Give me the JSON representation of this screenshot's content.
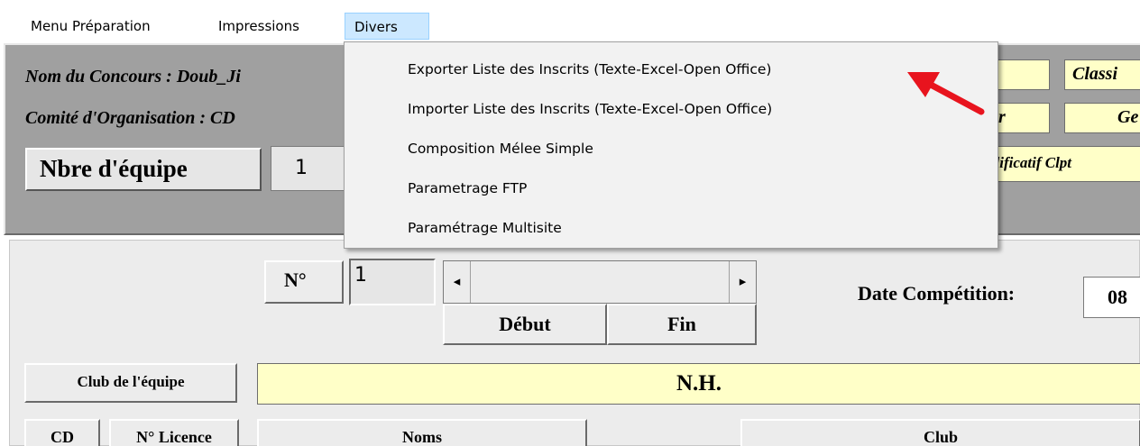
{
  "menubar": {
    "items": [
      {
        "label": "Menu Préparation"
      },
      {
        "label": "Impressions"
      },
      {
        "label": "Divers"
      }
    ]
  },
  "header": {
    "nom_concours": "Nom du Concours : Doub_Ji",
    "comite": "Comité d'Organisation : CD",
    "classement_partial": "Classi",
    "or_partial": "or",
    "ge_partial": "Ge",
    "qualificatif_partial": "alificatif Clpt",
    "nbre_label": "Nbre d'équipe",
    "nbre_value": "1"
  },
  "dropdown": {
    "items": [
      {
        "label": "Exporter Liste des Inscrits (Texte-Excel-Open Office)"
      },
      {
        "label": "Importer Liste des Inscrits (Texte-Excel-Open Office)"
      },
      {
        "label": "Composition  Mélee Simple"
      },
      {
        "label": "Parametrage FTP"
      },
      {
        "label": "Paramétrage Multisite"
      }
    ]
  },
  "form": {
    "numero_label": "N°",
    "numero_value": "1",
    "scroll_left": "◂",
    "scroll_right": "▸",
    "debut_label": "Début",
    "fin_label": "Fin",
    "date_label": "Date Compétition:",
    "date_value": "08",
    "club_label": "Club de l'équipe",
    "club_value": "N.H.",
    "columns": {
      "cd": "CD",
      "licence": "N° Licence",
      "noms": "Noms",
      "club": "Club"
    }
  },
  "colors": {
    "highlight_yellow": "#ffffc8",
    "menu_active": "#cce8ff",
    "arrow": "#e8141e"
  }
}
